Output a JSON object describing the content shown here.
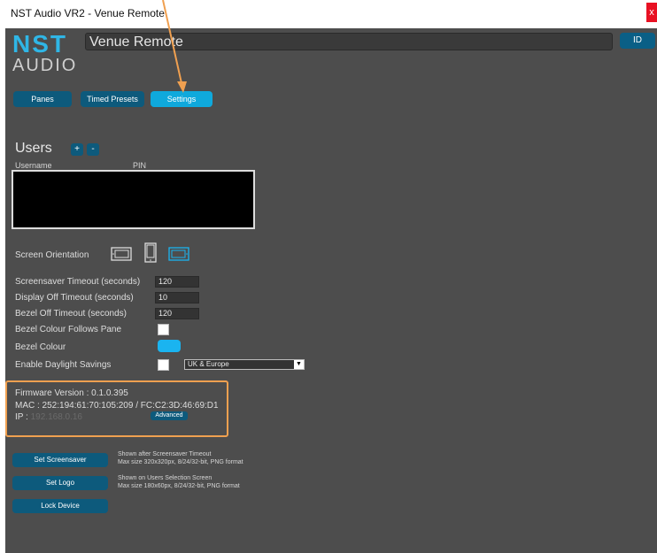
{
  "window": {
    "title": "NST Audio VR2 - Venue Remote",
    "close_label": "x"
  },
  "logo": {
    "line1": "NST",
    "line2": "AUDIO"
  },
  "header": {
    "device_name": "Venue Remote",
    "id_label": "ID"
  },
  "tabs": [
    {
      "label": "Panes"
    },
    {
      "label": "Timed Presets"
    },
    {
      "label": "Settings"
    }
  ],
  "users": {
    "heading": "Users",
    "add_label": "+",
    "remove_label": "-",
    "col_username": "Username",
    "col_pin": "PIN"
  },
  "settings": {
    "screen_orientation_label": "Screen Orientation",
    "screensaver_timeout_label": "Screensaver Timeout (seconds)",
    "screensaver_timeout_value": "120",
    "display_off_timeout_label": "Display Off Timeout (seconds)",
    "display_off_timeout_value": "10",
    "bezel_off_timeout_label": "Bezel Off Timeout (seconds)",
    "bezel_off_timeout_value": "120",
    "bezel_colour_follows_label": "Bezel Colour Follows Pane",
    "bezel_colour_label": "Bezel Colour",
    "bezel_colour_value": "#1ab4f0",
    "daylight_savings_label": "Enable Daylight Savings",
    "daylight_region_value": "UK & Europe",
    "dropdown_arrow": "▼"
  },
  "firmware": {
    "version_line": "Firmware Version : 0.1.0.395",
    "mac_line": "MAC : 252:194:61:70:105:209 / FC:C2:3D:46:69:D1",
    "ip_label": "IP : ",
    "ip_value": "192.168.0.16",
    "advanced_label": "Advanced"
  },
  "actions": {
    "set_screensaver_label": "Set Screensaver",
    "screensaver_desc1": "Shown after Screensaver Timeout",
    "screensaver_desc2": "Max size 320x320px, 8/24/32-bit, PNG format",
    "set_logo_label": "Set Logo",
    "logo_desc1": "Shown on Users Selection Screen",
    "logo_desc2": "Max size 180x60px, 8/24/32-bit, PNG format",
    "lock_device_label": "Lock Device"
  },
  "colors": {
    "accent": "#0fa9dc",
    "button": "#0d5a7c",
    "annotation": "#f0a050",
    "close": "#e81123"
  }
}
